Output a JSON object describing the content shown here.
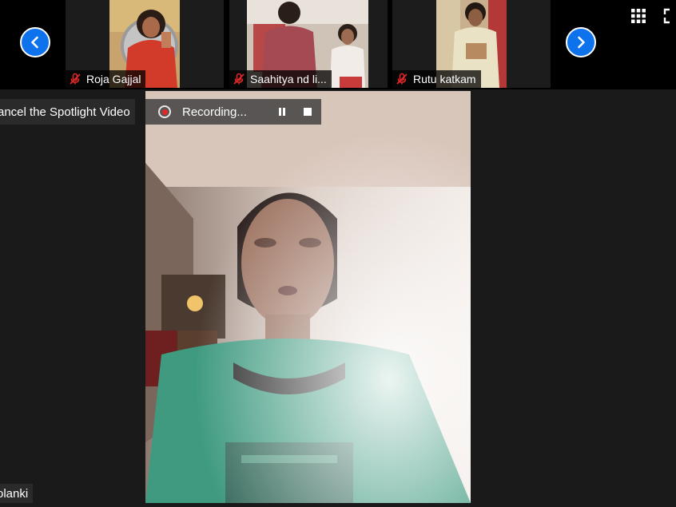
{
  "strip": {
    "participants": [
      {
        "name": "Roja Gajjal",
        "muted": true
      },
      {
        "name": "Saahitya nd li...",
        "muted": true
      },
      {
        "name": "Rutu katkam",
        "muted": true
      }
    ],
    "prev_icon": "chevron-left-icon",
    "next_icon": "chevron-right-icon",
    "grid_icon": "gallery-grid-icon",
    "fullscreen_icon": "fullscreen-icon"
  },
  "main": {
    "spotlight_button_label": "ancel the Spotlight Video",
    "recording": {
      "status_text": "Recording...",
      "pause_icon": "pause-icon",
      "stop_icon": "stop-icon"
    },
    "active_speaker_name": "olanki"
  },
  "colors": {
    "accent": "#0e72ed",
    "muted_icon": "#e02828",
    "background": "#1a1a1a"
  }
}
